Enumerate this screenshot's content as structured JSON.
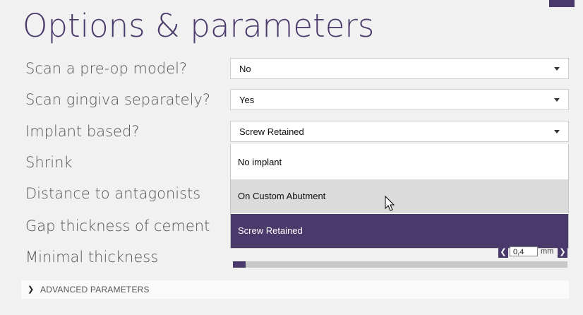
{
  "page": {
    "title": "Options & parameters",
    "accent": "#4a3a6b"
  },
  "labels": [
    "Scan a pre-op model?",
    "Scan gingiva separately?",
    "Implant based?",
    "Shrink",
    "Distance to antagonists",
    "Gap thickness of cement",
    "Minimal thickness"
  ],
  "selects": {
    "preop": {
      "value": "No"
    },
    "gingiva": {
      "value": "Yes"
    },
    "implant": {
      "value": "Screw Retained"
    }
  },
  "dropdown": {
    "options": [
      "No implant",
      "On Custom Abutment",
      "Screw Retained"
    ],
    "hovered": "On Custom Abutment",
    "selected": "Screw Retained"
  },
  "minimal_thickness": {
    "value": "0,4",
    "unit": "mm",
    "decrement_icon": "chevron-left-icon",
    "increment_icon": "chevron-right-icon"
  },
  "advanced": {
    "label": "ADVANCED PARAMETERS",
    "icon": "chevron-right-icon"
  }
}
